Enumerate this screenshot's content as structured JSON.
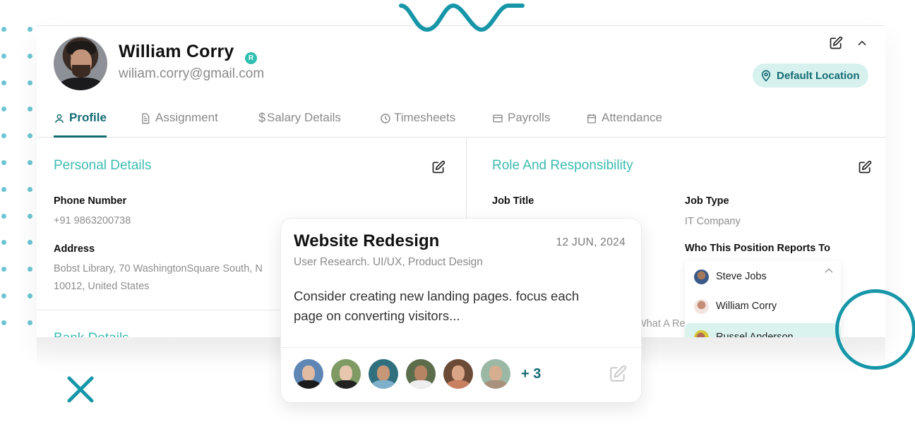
{
  "profile": {
    "name": "William Corry",
    "role_badge": "R",
    "email": "wiliam.corry@gmail.com",
    "location_label": "Default Location",
    "avatar_icon": "user-photo"
  },
  "header_actions": {
    "edit_icon": "edit-icon",
    "collapse_icon": "chevron-up-icon"
  },
  "tabs": [
    {
      "label": "Profile",
      "icon": "user-icon",
      "active": true
    },
    {
      "label": "Assignment",
      "icon": "document-icon",
      "active": false
    },
    {
      "label": "Salary Details",
      "icon": "dollar-icon",
      "active": false
    },
    {
      "label": "Timesheets",
      "icon": "clock-icon",
      "active": false
    },
    {
      "label": "Payrolls",
      "icon": "card-icon",
      "active": false
    },
    {
      "label": "Attendance",
      "icon": "calendar-icon",
      "active": false
    }
  ],
  "personal_details": {
    "title": "Personal Details",
    "phone_label": "Phone Number",
    "phone_value": "+91 9863200738",
    "address_label": "Address",
    "address_line1": "Bobst Library, 70 WashingtonSquare South, N",
    "address_line2": "10012, United States"
  },
  "bank_details": {
    "title": "Bank Details"
  },
  "role_responsibility": {
    "title": "Role And Responsibility",
    "job_title_label": "Job Title",
    "job_type_label": "Job Type",
    "job_type_value": "IT Company",
    "reports_to_label": "Who This Position Reports To",
    "partial_text": "What A Re",
    "reports_to_options": [
      {
        "name": "Steve Jobs",
        "selected": false
      },
      {
        "name": "William Corry",
        "selected": false
      },
      {
        "name": "Russel Anderson",
        "selected": true
      }
    ]
  },
  "task_card": {
    "title": "Website Redesign",
    "date": "12 JUN, 2024",
    "tags": "User Research. UI/UX, Product Design",
    "description": "Consider creating new landing pages. focus each page on converting visitors...",
    "assignee_count_visible": 6,
    "more_label": "+ 3"
  },
  "colors": {
    "accent": "#136b73",
    "section_title": "#3cbcb0",
    "pill_bg": "#d6f1ee",
    "decor": "#1696a8",
    "dots": "#6cc5d3"
  }
}
